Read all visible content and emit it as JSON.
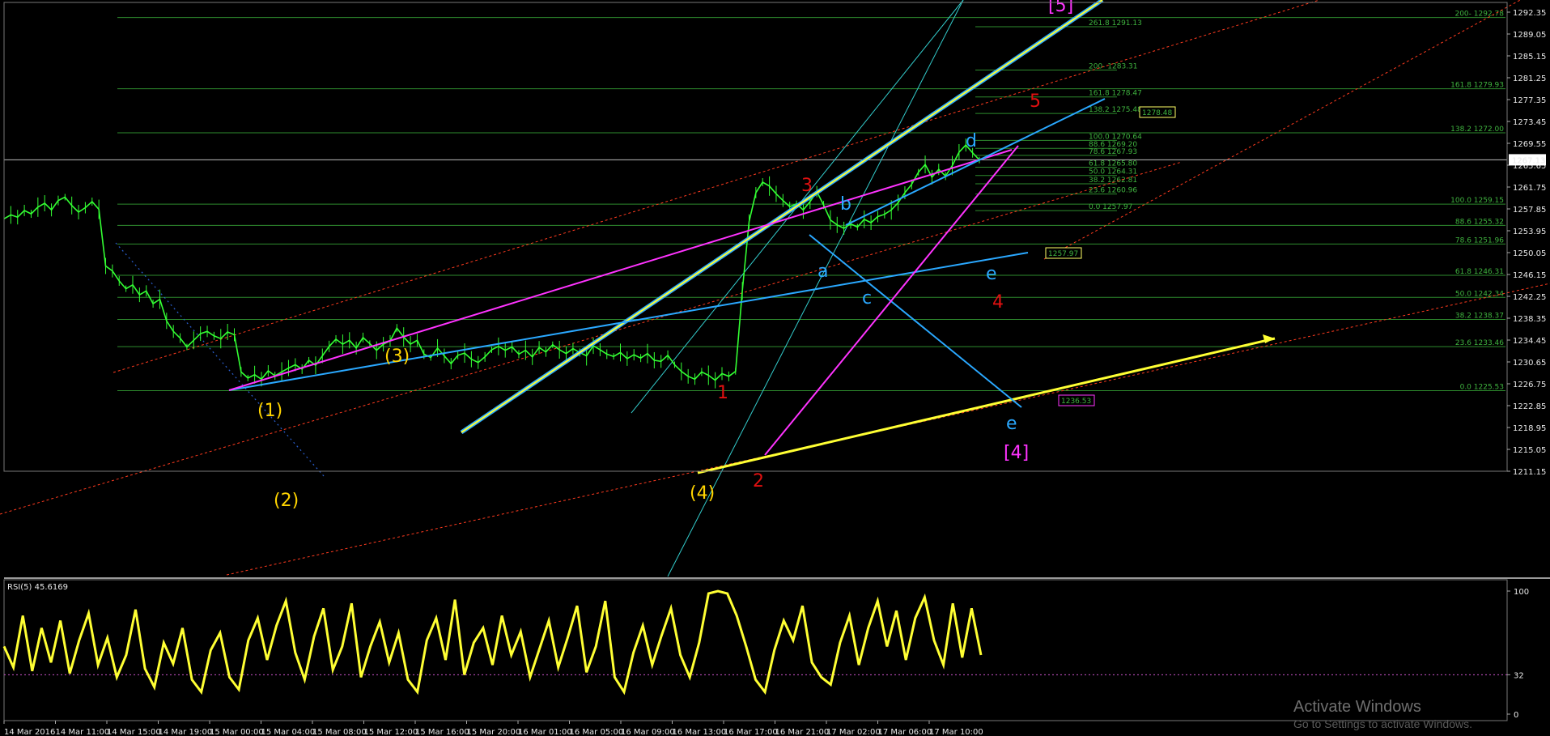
{
  "chart_data": {
    "type": "line",
    "price_axis": {
      "ylim": [
        1211.0,
        1295.5
      ],
      "ticks": [
        "1292.35",
        "1289.05",
        "1285.15",
        "1281.25",
        "1277.35",
        "1273.45",
        "1269.55",
        "1265.65",
        "1261.75",
        "1257.85",
        "1253.95",
        "1250.05",
        "1246.15",
        "1242.25",
        "1238.35",
        "1234.45",
        "1230.65",
        "1226.75",
        "1222.85",
        "1218.95",
        "1215.05",
        "1211.15"
      ],
      "current_price": "1267.13"
    },
    "time_axis": {
      "labels": [
        "14 Mar 2016",
        "14 Mar 11:00",
        "14 Mar 15:00",
        "14 Mar 19:00",
        "15 Mar 00:00",
        "15 Mar 04:00",
        "15 Mar 08:00",
        "15 Mar 12:00",
        "15 Mar 16:00",
        "15 Mar 20:00",
        "16 Mar 01:00",
        "16 Mar 05:00",
        "16 Mar 09:00",
        "16 Mar 13:00",
        "16 Mar 17:00",
        "16 Mar 21:00",
        "17 Mar 02:00",
        "17 Mar 06:00",
        "17 Mar 10:00"
      ]
    },
    "fib_left": [
      {
        "label": "200- 1292.78",
        "price": 1292.78
      },
      {
        "label": "161.8 1279.93",
        "price": 1279.93
      },
      {
        "label": "138.2 1272.00",
        "price": 1272.0
      },
      {
        "label": "100.0 1259.15",
        "price": 1259.15
      },
      {
        "label": "88.6 1255.32",
        "price": 1255.32
      },
      {
        "label": "78.6 1251.96",
        "price": 1251.96
      },
      {
        "label": "61.8 1246.31",
        "price": 1246.31
      },
      {
        "label": "50.0 1242.34",
        "price": 1242.34
      },
      {
        "label": "38.2 1238.37",
        "price": 1238.37
      },
      {
        "label": "23.6 1233.46",
        "price": 1233.46
      },
      {
        "label": "0.0 1225.53",
        "price": 1225.53
      }
    ],
    "fib_right": [
      {
        "label": "261.8 1291.13",
        "price": 1291.13
      },
      {
        "label": "200- 1283.31",
        "price": 1283.31
      },
      {
        "label": "161.8 1278.47",
        "price": 1278.47
      },
      {
        "label": "138.2 1275.48",
        "price": 1275.48
      },
      {
        "label": "100.0 1270.64",
        "price": 1270.64
      },
      {
        "label": "88.6 1269.20",
        "price": 1269.2
      },
      {
        "label": "78.6 1267.93",
        "price": 1267.93
      },
      {
        "label": "61.8 1265.80",
        "price": 1265.8
      },
      {
        "label": "50.0 1264.31",
        "price": 1264.31
      },
      {
        "label": "38.2 1262.81",
        "price": 1262.81
      },
      {
        "label": "23.6 1260.96",
        "price": 1260.96
      },
      {
        "label": "0.0 1257.97",
        "price": 1257.97
      }
    ],
    "price_boxes": [
      {
        "label": "1278.48",
        "color": "#ffff66"
      },
      {
        "label": "1257.97",
        "color": "#ffff66"
      },
      {
        "label": "1236.53",
        "color": "#ff33ff"
      }
    ],
    "price_series": [
      1256.5,
      1257.2,
      1256.8,
      1258.0,
      1257.4,
      1258.6,
      1259.3,
      1258.1,
      1259.8,
      1260.4,
      1258.9,
      1257.7,
      1258.5,
      1259.6,
      1258.2,
      1248.0,
      1247.1,
      1245.3,
      1243.9,
      1244.6,
      1242.8,
      1243.5,
      1241.2,
      1242.0,
      1238.1,
      1236.2,
      1235.0,
      1233.4,
      1234.6,
      1235.8,
      1236.2,
      1235.4,
      1234.9,
      1236.1,
      1235.6,
      1228.9,
      1227.8,
      1228.4,
      1227.6,
      1229.1,
      1228.2,
      1228.9,
      1229.6,
      1230.2,
      1229.4,
      1231.0,
      1230.1,
      1231.8,
      1233.5,
      1234.8,
      1233.9,
      1234.6,
      1233.2,
      1235.1,
      1234.0,
      1232.8,
      1233.9,
      1234.5,
      1236.8,
      1235.2,
      1233.9,
      1234.6,
      1232.1,
      1231.5,
      1233.2,
      1231.8,
      1230.4,
      1231.9,
      1232.3,
      1231.2,
      1230.6,
      1231.6,
      1232.9,
      1233.5,
      1232.8,
      1233.4,
      1232.1,
      1232.8,
      1231.6,
      1233.3,
      1232.5,
      1233.8,
      1232.9,
      1232.2,
      1233.1,
      1232.4,
      1231.8,
      1233.6,
      1232.9,
      1232.1,
      1231.7,
      1232.4,
      1231.3,
      1232.0,
      1231.4,
      1232.2,
      1231.0,
      1230.8,
      1231.9,
      1230.2,
      1229.0,
      1228.1,
      1227.6,
      1228.9,
      1228.3,
      1227.4,
      1228.6,
      1228.1,
      1229.0,
      1243.5,
      1256.0,
      1261.2,
      1263.1,
      1262.4,
      1261.0,
      1259.8,
      1258.7,
      1259.2,
      1258.1,
      1259.6,
      1261.4,
      1259.0,
      1256.3,
      1255.4,
      1254.8,
      1255.6,
      1255.0,
      1256.4,
      1255.8,
      1256.9,
      1257.3,
      1258.1,
      1259.4,
      1261.2,
      1262.7,
      1264.9,
      1266.3,
      1264.0,
      1265.4,
      1264.2,
      1266.1,
      1268.5,
      1269.8,
      1268.4,
      1267.1
    ],
    "rsi": {
      "label": "RSI(5) 45.6169",
      "period": 5,
      "value": 45.6169,
      "ylim": [
        0,
        100
      ],
      "ticks": [
        "100",
        "32",
        "0"
      ],
      "level": 32,
      "values": [
        55,
        38,
        80,
        35,
        70,
        42,
        76,
        33,
        60,
        82,
        40,
        62,
        30,
        48,
        85,
        37,
        22,
        58,
        41,
        70,
        28,
        18,
        52,
        66,
        30,
        20,
        60,
        78,
        44,
        72,
        92,
        50,
        28,
        63,
        86,
        36,
        55,
        90,
        30,
        55,
        75,
        42,
        66,
        28,
        18,
        60,
        78,
        44,
        93,
        32,
        58,
        70,
        40,
        80,
        48,
        67,
        30,
        53,
        76,
        38,
        62,
        88,
        34,
        55,
        92,
        30,
        18,
        50,
        72,
        40,
        64,
        86,
        48,
        30,
        58,
        98,
        100,
        98,
        80,
        55,
        28,
        18,
        52,
        76,
        60,
        88,
        42,
        30,
        24,
        58,
        80,
        40,
        70,
        92,
        55,
        84,
        44,
        78,
        95,
        60,
        40,
        90,
        46,
        86,
        48
      ]
    },
    "wave_labels": [
      {
        "text": "(1)",
        "color": "#ffd400"
      },
      {
        "text": "(2)",
        "color": "#ffd400"
      },
      {
        "text": "(3)",
        "color": "#ffd400"
      },
      {
        "text": "(4)",
        "color": "#ffd400"
      },
      {
        "text": "1",
        "color": "#e01010"
      },
      {
        "text": "2",
        "color": "#e01010"
      },
      {
        "text": "3",
        "color": "#e01010"
      },
      {
        "text": "4",
        "color": "#e01010"
      },
      {
        "text": "5",
        "color": "#e01010"
      },
      {
        "text": "a",
        "color": "#2aa8ff"
      },
      {
        "text": "b",
        "color": "#2aa8ff"
      },
      {
        "text": "c",
        "color": "#2aa8ff"
      },
      {
        "text": "d",
        "color": "#2aa8ff"
      },
      {
        "text": "e",
        "color": "#2aa8ff"
      },
      {
        "text": "e",
        "color": "#2aa8ff"
      },
      {
        "text": "[4]",
        "color": "#ff33ff"
      },
      {
        "text": "[5]",
        "color": "#ff33ff"
      }
    ],
    "colors": {
      "candles": "#33ff33",
      "fib_lines": "#2e8b2e",
      "channel": "#ff3b1f",
      "trend_yellow": "#ffff33",
      "trend_blue": "#2aa8ff",
      "trend_magenta": "#ff33ff",
      "cyan": "#33cccc",
      "rsi": "#ffff33"
    }
  },
  "watermark": {
    "title": "Activate Windows",
    "subtitle": "Go to Settings to activate Windows."
  }
}
